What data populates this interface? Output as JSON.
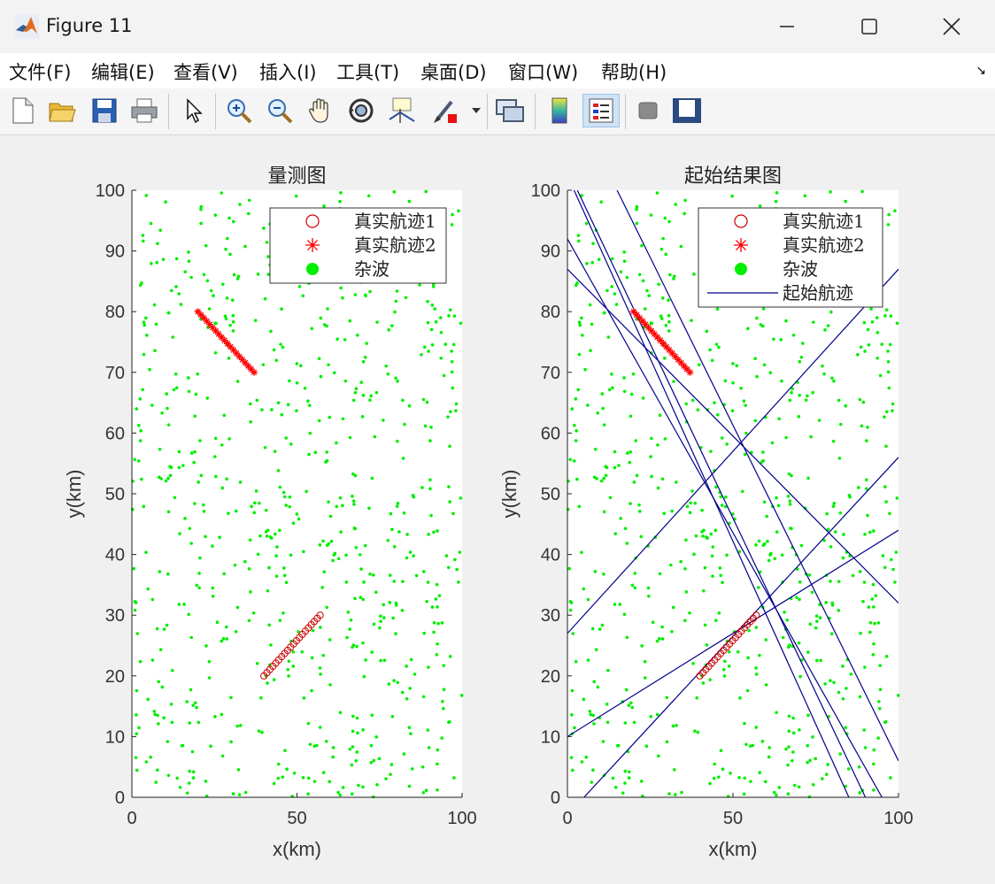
{
  "window": {
    "title": "Figure 11"
  },
  "menu": [
    "文件(F)",
    "编辑(E)",
    "查看(V)",
    "插入(I)",
    "工具(T)",
    "桌面(D)",
    "窗口(W)",
    "帮助(H)"
  ],
  "toolbar": [
    "new-figure-icon",
    "open-file-icon",
    "save-icon",
    "print-icon",
    "pointer-icon",
    "zoom-in-icon",
    "zoom-out-icon",
    "pan-hand-icon",
    "rotate-3d-icon",
    "data-cursor-icon",
    "brush-icon",
    "brush-dropdown-icon",
    "link-plot-icon",
    "colorbar-icon",
    "legend-icon",
    "hide-plot-tools-icon",
    "show-plot-tools-icon"
  ],
  "axes": [
    {
      "title": "量测图",
      "xlabel": "x(km)",
      "ylabel": "y(km)",
      "xlim": [
        0,
        100
      ],
      "ylim": [
        0,
        100
      ],
      "xticks": [
        "0",
        "50",
        "100"
      ],
      "yticks": [
        "0",
        "10",
        "20",
        "30",
        "40",
        "50",
        "60",
        "70",
        "80",
        "90",
        "100"
      ],
      "legend": [
        {
          "marker": "circle",
          "label": "真实航迹1"
        },
        {
          "marker": "star",
          "label": "真实航迹2"
        },
        {
          "marker": "dot",
          "label": "杂波"
        }
      ]
    },
    {
      "title": "起始结果图",
      "xlabel": "x(km)",
      "ylabel": "y(km)",
      "xlim": [
        0,
        100
      ],
      "ylim": [
        0,
        100
      ],
      "xticks": [
        "0",
        "50",
        "100"
      ],
      "yticks": [
        "0",
        "10",
        "20",
        "30",
        "40",
        "50",
        "60",
        "70",
        "80",
        "90",
        "100"
      ],
      "legend": [
        {
          "marker": "circle",
          "label": "真实航迹1"
        },
        {
          "marker": "star",
          "label": "真实航迹2"
        },
        {
          "marker": "dot",
          "label": "杂波"
        },
        {
          "marker": "line",
          "label": "起始航迹"
        }
      ]
    }
  ],
  "chart_data": {
    "type": "scatter",
    "colors": {
      "track1": "#cc0000",
      "track2": "#ff0000",
      "clutter": "#00ee00",
      "start_tracks": "#00008b"
    },
    "track1": {
      "x_start": 40,
      "y_start": 20,
      "x_end": 57,
      "y_end": 30,
      "points": 20
    },
    "track2": {
      "x_start": 20,
      "y_start": 80,
      "x_end": 37,
      "y_end": 70,
      "points": 20
    },
    "clutter_count": 700,
    "start_tracks": [
      [
        [
          2,
          100
        ],
        [
          85,
          0
        ]
      ],
      [
        [
          3,
          100
        ],
        [
          90,
          0
        ]
      ],
      [
        [
          0,
          92
        ],
        [
          95,
          0
        ]
      ],
      [
        [
          0,
          87
        ],
        [
          100,
          32
        ]
      ],
      [
        [
          0,
          27
        ],
        [
          100,
          87
        ]
      ],
      [
        [
          5,
          0
        ],
        [
          100,
          56
        ]
      ],
      [
        [
          0,
          10
        ],
        [
          100,
          44
        ]
      ],
      [
        [
          15,
          100
        ],
        [
          100,
          6
        ]
      ]
    ]
  }
}
